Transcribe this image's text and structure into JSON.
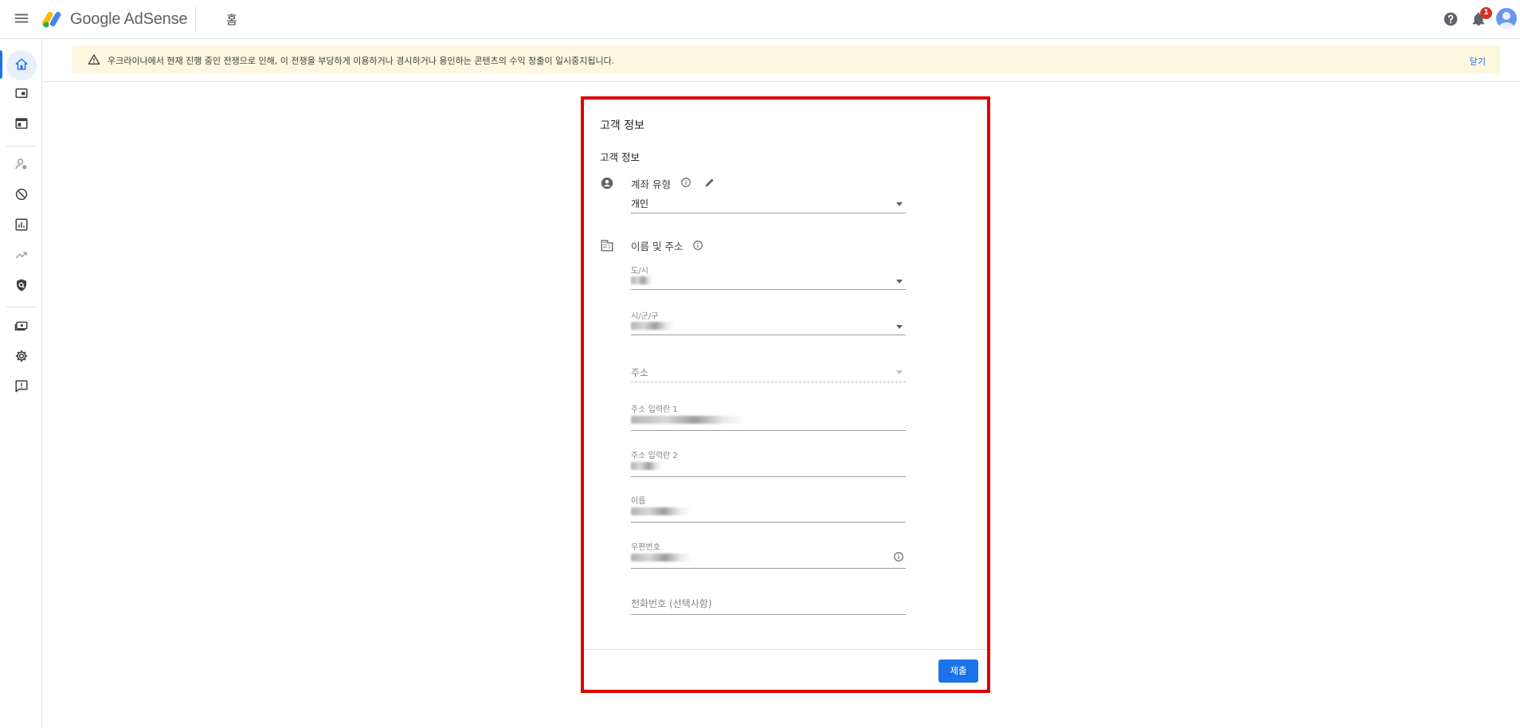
{
  "app": {
    "brand": "Google AdSense",
    "page_title": "홈"
  },
  "header": {
    "notification_count": "1"
  },
  "sidebar": {
    "items": [
      {
        "icon": "home-icon",
        "active": true
      },
      {
        "icon": "ads-icon"
      },
      {
        "icon": "sites-icon"
      },
      {
        "icon": "privacy-messaging-icon"
      },
      {
        "icon": "blocking-controls-icon"
      },
      {
        "icon": "reports-icon"
      },
      {
        "icon": "optimization-icon"
      },
      {
        "icon": "brand-safety-icon"
      },
      {
        "icon": "payments-icon"
      },
      {
        "icon": "settings-icon"
      },
      {
        "icon": "feedback-icon"
      }
    ]
  },
  "banner": {
    "text": "우크라이나에서 현재 진행 중인 전쟁으로 인해, 이 전쟁을 부당하게 이용하거나 경시하거나 용인하는 콘텐츠의 수익 창출이 일시중지됩니다.",
    "close_label": "닫기"
  },
  "form": {
    "card_title": "고객 정보",
    "section_title": "고객 정보",
    "account_type": {
      "label": "계좌 유형",
      "value": "개인"
    },
    "name_address": {
      "label": "이름 및 주소"
    },
    "fields": {
      "province": {
        "label": "도/시"
      },
      "city": {
        "label": "시/군/구"
      },
      "address": {
        "placeholder": "주소"
      },
      "address_line1": {
        "label": "주소 입력란 1"
      },
      "address_line2": {
        "label": "주소 입력란 2"
      },
      "name": {
        "label": "이름"
      },
      "postal_code": {
        "label": "우편번호"
      },
      "phone": {
        "placeholder": "전화번호 (선택사항)"
      }
    },
    "submit_label": "제출"
  }
}
